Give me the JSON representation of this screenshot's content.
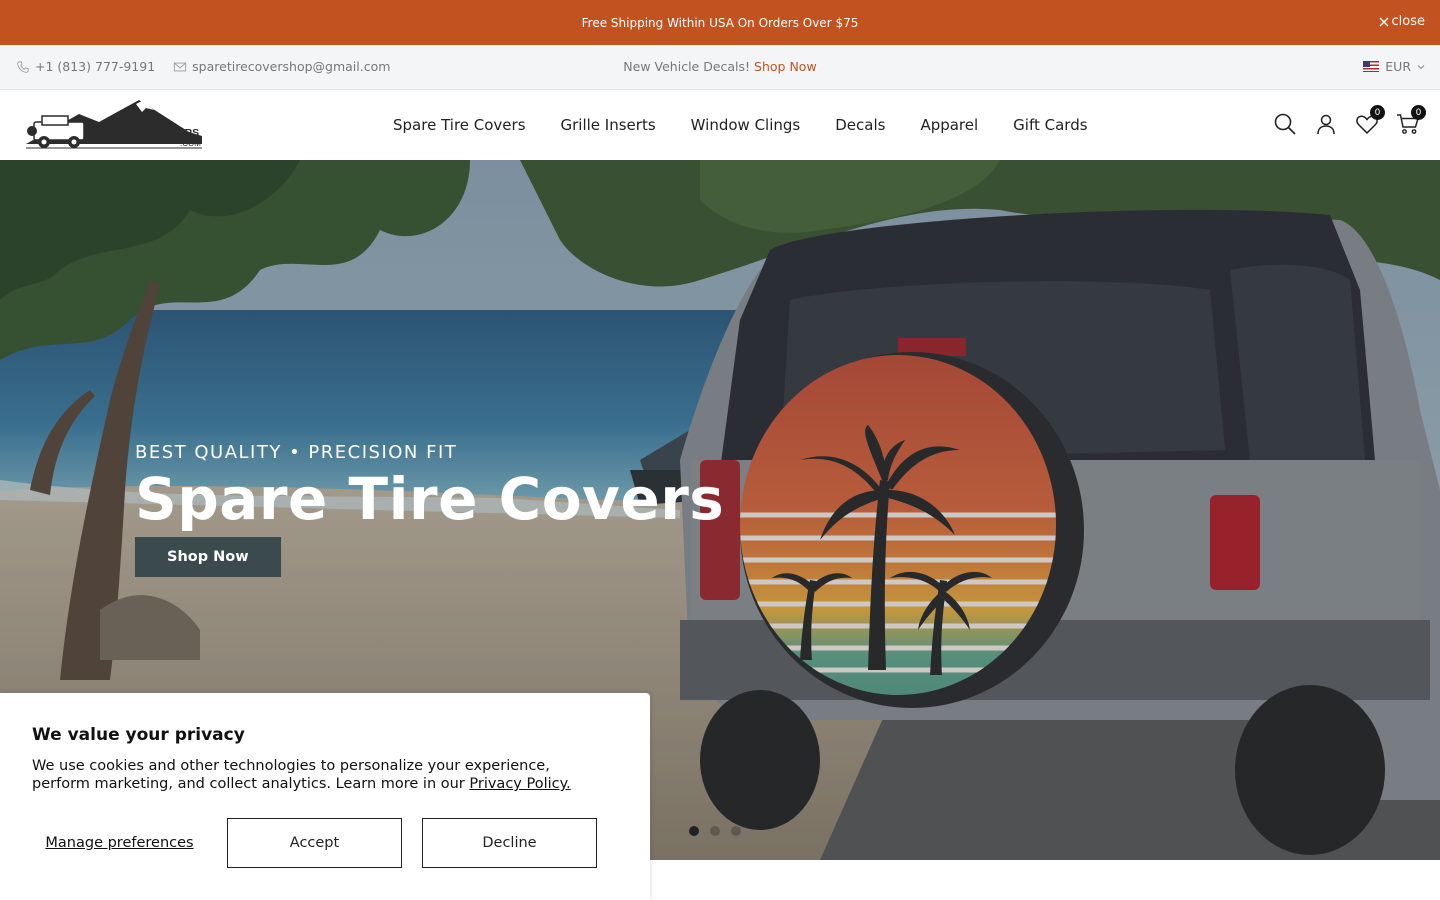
{
  "announcement": {
    "text": "Free Shipping Within USA On Orders Over $75",
    "close_label": "close"
  },
  "topbar": {
    "phone": "+1 (813) 777-9191",
    "email": "sparetirecovershop@gmail.com",
    "promo_text": "New Vehicle Decals!",
    "promo_link": "Shop Now",
    "currency": "EUR"
  },
  "header": {
    "logo_text": "SPARE-TIRECOVERS",
    "logo_sub": ".COM",
    "nav": [
      "Spare Tire Covers",
      "Grille Inserts",
      "Window Clings",
      "Decals",
      "Apparel",
      "Gift Cards"
    ],
    "wishlist_count": "0",
    "cart_count": "0"
  },
  "hero": {
    "subtitle": "BEST QUALITY • PRECISION FIT",
    "title": "Spare Tire Covers",
    "button": "Shop Now",
    "slides": 3,
    "active_slide": 1
  },
  "cookie": {
    "title": "We value your privacy",
    "body": "We use cookies and other technologies to personalize your experience, perform marketing, and collect analytics. Learn more in our",
    "policy_link": "Privacy Policy.",
    "manage": "Manage preferences",
    "accept": "Accept",
    "decline": "Decline"
  },
  "colors": {
    "announcement_bg": "#c2521f",
    "accent": "#c2521f",
    "hero_button": "#3b4a4c"
  }
}
